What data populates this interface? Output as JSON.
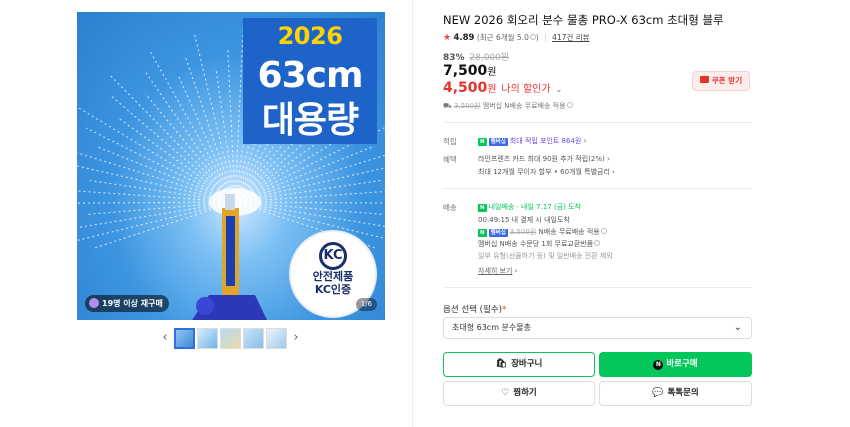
{
  "hero": {
    "line1": "2026 NEW",
    "line2": "63cm",
    "line3": "대용량",
    "kc_logo": "KC",
    "kc_line1": "안전제품",
    "kc_line2": "KC인증",
    "repurchase": "19명 이상 재구매",
    "counter": "1/6"
  },
  "thumbs": {
    "prev": "‹",
    "next": "›"
  },
  "product": {
    "title": "NEW 2026 회오리 분수 물총 PRO-X 63cm 초대형 블루",
    "rating": "4.89",
    "rating_note": "(최근 6개월 5.0",
    "rating_note_end": ")",
    "reviews": "417건 리뷰",
    "discount_pct": "83%",
    "original_price": "28,000원",
    "price": "7,500",
    "price_won": "원",
    "my_price": "4,500",
    "my_price_won": "원",
    "my_price_label": "나의 할인가",
    "coupon": "쿠폰 받기",
    "shipping_prefix": "3,500원",
    "shipping_rest": "멤버십 N배송 무료배송 적용"
  },
  "benefits": {
    "earn_label": "적립",
    "earn_text": "최대 적립 포인트 864원",
    "benefit_label": "혜택",
    "benefit_line1": "라인프렌즈 카드 최대 90원 추가 적립(2%)",
    "benefit_line2": "최대 12개월 무이자 할부 • 60개월 특별금리"
  },
  "delivery": {
    "label": "배송",
    "line1_tag": "내일배송",
    "line1_rest": "· 내일 7.17 (금) 도착",
    "line2": "00:49:15  내 결제 시 내일도착",
    "line3_strike": "3,500원",
    "line3_rest": "N배송 무료배송 적용",
    "line4": "멤버십 N배송 수문당 1회 무료교환반품",
    "line5": "일부 유형(선물하기 등) 및 일반배송 전환 제외",
    "more": "자세히 보기"
  },
  "option": {
    "label": "옵션 선택 (필수)",
    "required_mark": "*",
    "selected": "초대형 63cm 분수물총"
  },
  "actions": {
    "cart": "장바구니",
    "buy": "바로구매",
    "wish": "찜하기",
    "talk": "톡톡문의"
  },
  "badges": {
    "npay": "N",
    "plus": "멤버십"
  },
  "colors": {
    "accent": "#03c75a",
    "sale": "#e8332d",
    "point": "#6b47e0"
  }
}
